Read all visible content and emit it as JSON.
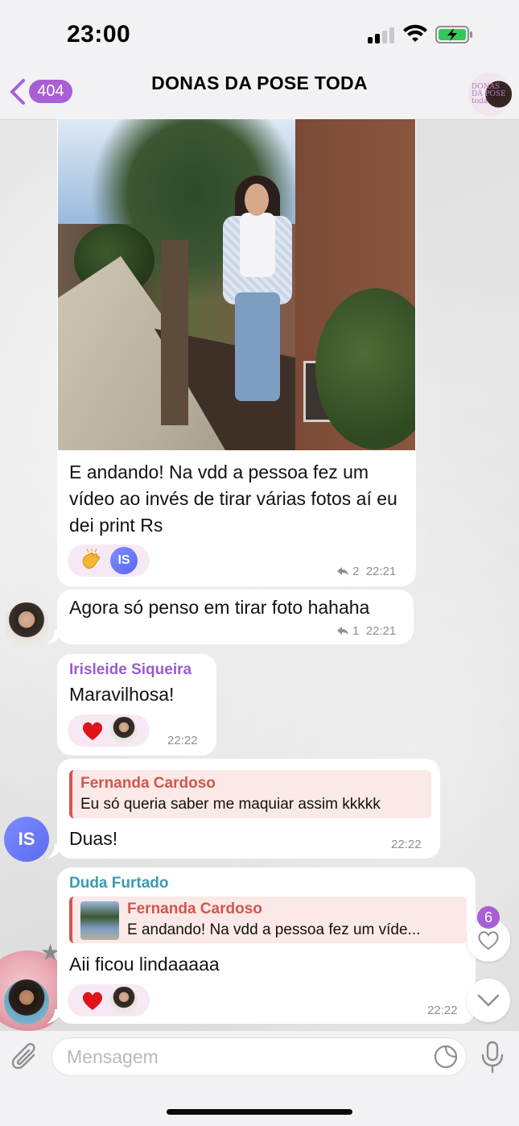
{
  "status_bar": {
    "time": "23:00"
  },
  "header": {
    "back_count": "404",
    "title": "DONAS DA POSE TODA",
    "avatar_text": "DONAS DA POSE toda"
  },
  "messages": {
    "photo_caption": {
      "text": "E andando! Na vdd a pessoa fez um vídeo ao invés de tirar várias fotos aí eu dei print Rs",
      "reaction_avatar": "IS",
      "replies": "2",
      "time": "22:21"
    },
    "second": {
      "text": "Agora só penso em tirar foto hahaha",
      "replies": "1",
      "time": "22:21"
    },
    "irisleide": {
      "sender": "Irisleide Siqueira",
      "text": "Maravilhosa!",
      "time": "22:22"
    },
    "reply_duas": {
      "quote_name": "Fernanda Cardoso",
      "quote_text": "Eu só queria saber me maquiar assim kkkkk",
      "text": "Duas!",
      "time": "22:22",
      "sender_avatar": "IS"
    },
    "duda": {
      "sender": "Duda Furtado",
      "quote_name": "Fernanda Cardoso",
      "quote_text": "E andando! Na vdd a pessoa fez um víde...",
      "text": "Aii ficou lindaaaaa",
      "time": "22:22"
    }
  },
  "side": {
    "reactions_count": "6"
  },
  "composer": {
    "placeholder": "Mensagem"
  },
  "colors": {
    "accent": "#a85fd6",
    "irisleide_name": "#9b5bd0",
    "duda_name": "#3a9bb3",
    "quote_name": "#d0564d"
  },
  "icons": {
    "back": "chevron-left-icon",
    "reply_count": "reply-arrow-icon",
    "clap": "clapping-hands-icon",
    "heart": "red-heart-icon",
    "side_reactions": "heart-outline-icon",
    "scroll_down": "chevron-down-icon",
    "attach": "paperclip-icon",
    "sticker": "sticker-icon",
    "mic": "microphone-icon"
  }
}
